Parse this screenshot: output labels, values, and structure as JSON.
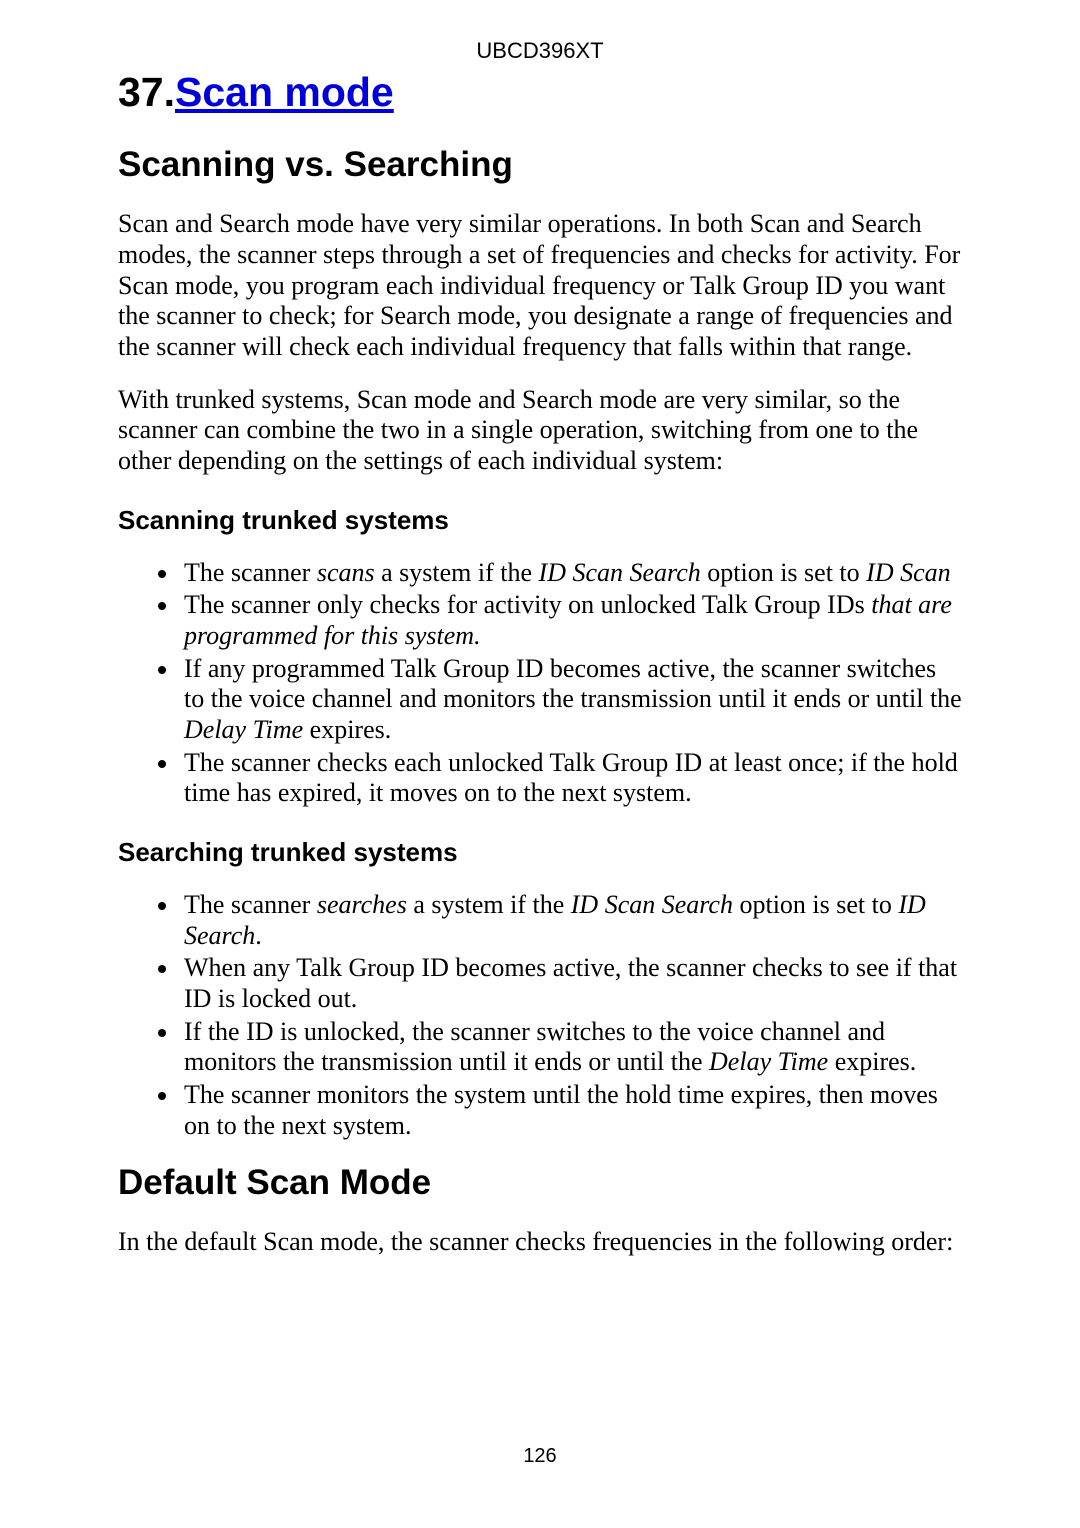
{
  "header": {
    "model": "UBCD396XT"
  },
  "title": {
    "number": "37.",
    "link_text": "Scan mode"
  },
  "sections": {
    "scanning_vs_searching": {
      "heading": "Scanning vs. Searching",
      "p1": "Scan and Search mode have very similar operations. In both Scan and Search modes, the scanner steps through a set of frequencies and checks for activity. For Scan mode, you program each individual frequency or Talk Group ID you want the scanner to check; for Search mode, you designate a range of frequencies and the scanner will check each individual frequency that falls within that range.",
      "p2": "With trunked systems, Scan mode and Search mode are very similar, so the scanner can combine the two in a single operation, switching from one to the other depending on the settings of each individual system:"
    },
    "scanning_trunked": {
      "heading": "Scanning trunked systems",
      "bullets": {
        "b1": {
          "pre": "The scanner ",
          "i1": "scans",
          "mid": " a system if the ",
          "i2": "ID Scan Search",
          "mid2": " option is set to ",
          "i3": "ID Scan"
        },
        "b2": {
          "pre": "The scanner only checks for activity on unlocked Talk Group IDs ",
          "i1": "that are programmed for this system."
        },
        "b3": {
          "pre": "If any programmed Talk Group ID becomes active, the scanner switches to the voice channel and monitors the transmission until it ends or until the ",
          "i1": "Delay Time",
          "post": " expires."
        },
        "b4": "The scanner checks each unlocked Talk Group ID at least once; if the hold time has expired, it moves on to the next system."
      }
    },
    "searching_trunked": {
      "heading": "Searching trunked systems",
      "bullets": {
        "b1": {
          "pre": "The scanner ",
          "i1": "searches",
          "mid": " a system if the ",
          "i2": "ID Scan Search",
          "mid2": " option is set to ",
          "i3": "ID Search",
          "post": "."
        },
        "b2": "When any Talk Group ID becomes active, the scanner checks to see if that ID is locked out.",
        "b3": {
          "pre": "If the ID is unlocked, the scanner switches to the voice channel and monitors the transmission until it ends or until the ",
          "i1": "Delay Time",
          "post": " expires."
        },
        "b4": "The scanner monitors the system until the hold time expires, then moves on to the next system."
      }
    },
    "default_scan_mode": {
      "heading": "Default Scan Mode",
      "p1": "In the default Scan mode, the scanner checks frequencies in the following order:"
    }
  },
  "footer": {
    "page_number": "126"
  }
}
